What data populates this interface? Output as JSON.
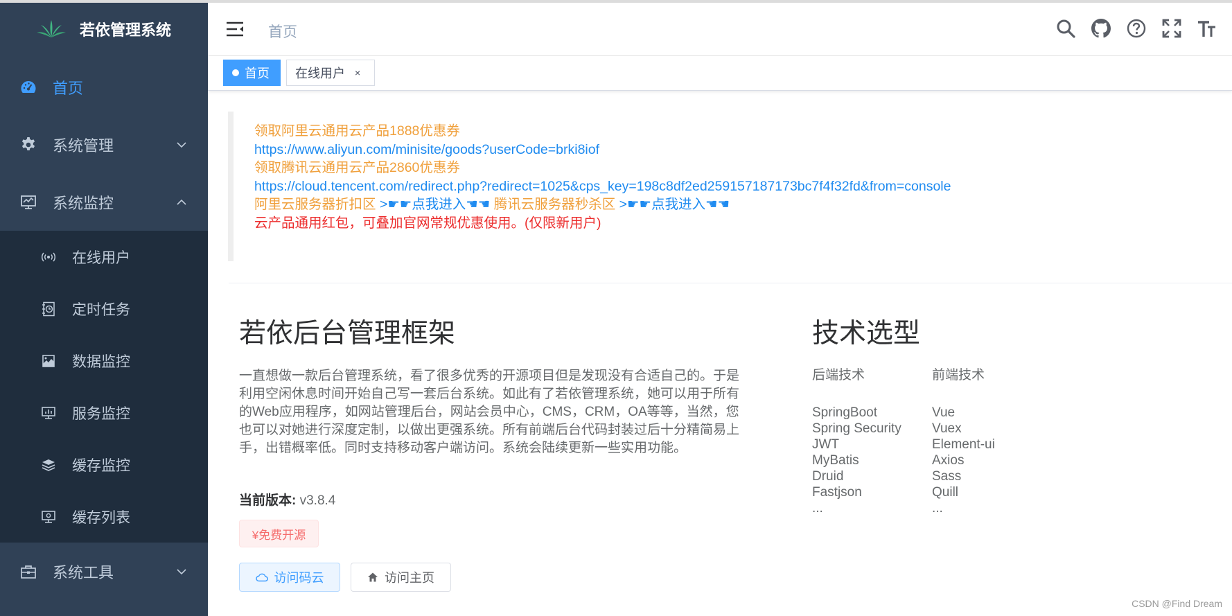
{
  "app": {
    "title": "若依管理系统"
  },
  "sidebar": {
    "items": [
      {
        "label": "首页",
        "icon": "dashboard-icon",
        "active": true
      },
      {
        "label": "系统管理",
        "icon": "gear-icon",
        "expanded": false
      },
      {
        "label": "系统监控",
        "icon": "monitor-icon",
        "expanded": true,
        "children": [
          {
            "label": "在线用户",
            "icon": "online-icon"
          },
          {
            "label": "定时任务",
            "icon": "job-icon"
          },
          {
            "label": "数据监控",
            "icon": "druid-icon"
          },
          {
            "label": "服务监控",
            "icon": "server-icon"
          },
          {
            "label": "缓存监控",
            "icon": "redis-icon"
          },
          {
            "label": "缓存列表",
            "icon": "redis-list-icon"
          }
        ]
      },
      {
        "label": "系统工具",
        "icon": "tool-icon",
        "expanded": false
      }
    ]
  },
  "navbar": {
    "breadcrumb": "首页",
    "icons": [
      "search-icon",
      "github-icon",
      "question-icon",
      "fullscreen-icon",
      "font-size-icon"
    ]
  },
  "tags": [
    {
      "label": "首页",
      "active": true
    },
    {
      "label": "在线用户",
      "close": "×"
    }
  ],
  "notice": {
    "line1": "领取阿里云通用云产品1888优惠券",
    "line2": "https://www.aliyun.com/minisite/goods?userCode=brki8iof",
    "line3": "领取腾讯云通用云产品2860优惠券",
    "line4": "https://cloud.tencent.com/redirect.php?redirect=1025&cps_key=198c8df2ed259157187173bc7f4f32fd&from=console",
    "line5a": "阿里云服务器折扣区",
    "line5b": ">☛☛点我进入☚☚",
    "line5c": "腾讯云服务器秒杀区",
    "line5d": ">☛☛点我进入☚☚",
    "line6": "云产品通用红包，可叠加官网常规优惠使用。(仅限新用户)"
  },
  "main": {
    "title": "若依后台管理框架",
    "intro": "一直想做一款后台管理系统，看了很多优秀的开源项目但是发现没有合适自己的。于是利用空闲休息时间开始自己写一套后台系统。如此有了若依管理系统，她可以用于所有的Web应用程序，如网站管理后台，网站会员中心，CMS，CRM，OA等等，当然，您也可以对她进行深度定制，以做出更强系统。所有前端后台代码封装过后十分精简易上手，出错概率低。同时支持移动客户端访问。系统会陆续更新一些实用功能。",
    "version_label": "当前版本:",
    "version_value": "v3.8.4",
    "free_tag": "¥免费开源",
    "btn_gitee": "访问码云",
    "btn_home": "访问主页"
  },
  "tech": {
    "title": "技术选型",
    "backend": {
      "heading": "后端技术",
      "items": [
        "SpringBoot",
        "Spring Security",
        "JWT",
        "MyBatis",
        "Druid",
        "Fastjson",
        "..."
      ]
    },
    "frontend": {
      "heading": "前端技术",
      "items": [
        "Vue",
        "Vuex",
        "Element-ui",
        "Axios",
        "Sass",
        "Quill",
        "..."
      ]
    }
  },
  "watermark": "CSDN @Find Dream",
  "colors": {
    "sidebar_bg": "#304156",
    "submenu_bg": "#1f2d3d",
    "primary": "#409eff",
    "notice_orange": "#f0a03c",
    "notice_blue": "#1f8bf0",
    "notice_red": "#ec2d2d"
  }
}
